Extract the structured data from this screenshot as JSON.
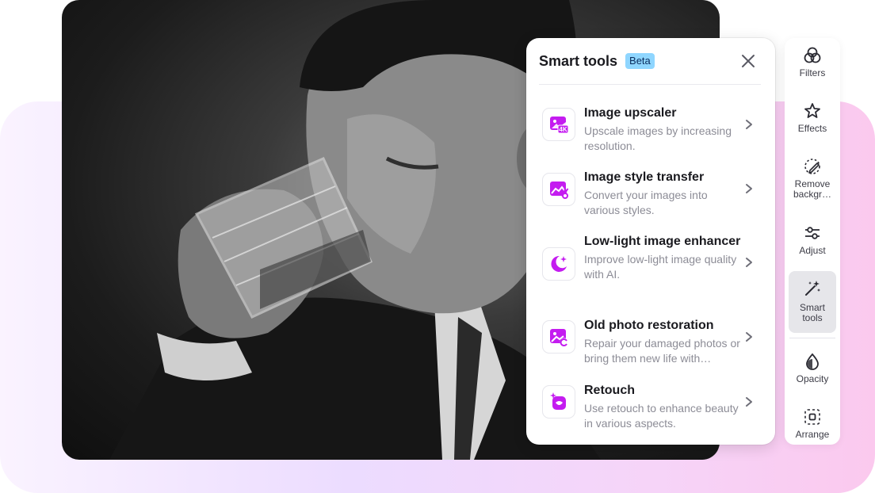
{
  "panel": {
    "title": "Smart tools",
    "badge": "Beta",
    "close_icon": "close-icon",
    "tools": [
      {
        "title": "Image upscaler",
        "desc": "Upscale images by increasing resolution.",
        "icon": "image-4k-icon"
      },
      {
        "title": "Image style transfer",
        "desc": "Convert your images into various styles.",
        "icon": "style-transfer-icon"
      },
      {
        "title": "Low-light image enhancer",
        "desc": "Improve low-light image quality with AI.",
        "icon": "moon-sparkle-icon"
      },
      {
        "title": "Old photo restoration",
        "desc": "Repair your damaged photos or bring them new life with…",
        "icon": "photo-restore-icon"
      },
      {
        "title": "Retouch",
        "desc": "Use retouch to enhance beauty in various aspects.",
        "icon": "retouch-icon"
      }
    ]
  },
  "sidebar": {
    "items": [
      {
        "label": "Filters",
        "icon": "filters-icon"
      },
      {
        "label": "Effects",
        "icon": "effects-star-icon"
      },
      {
        "label": "Remove backgr…",
        "icon": "remove-background-icon"
      },
      {
        "label": "Adjust",
        "icon": "adjust-sliders-icon"
      },
      {
        "label": "Smart tools",
        "icon": "magic-wand-icon",
        "active": true
      },
      {
        "label": "Opacity",
        "icon": "opacity-drop-icon"
      },
      {
        "label": "Arrange",
        "icon": "arrange-icon"
      }
    ]
  },
  "colors": {
    "accent": "#c41cf0",
    "badge_bg": "#8fd6ff",
    "active_bg": "#e6e6ea"
  }
}
